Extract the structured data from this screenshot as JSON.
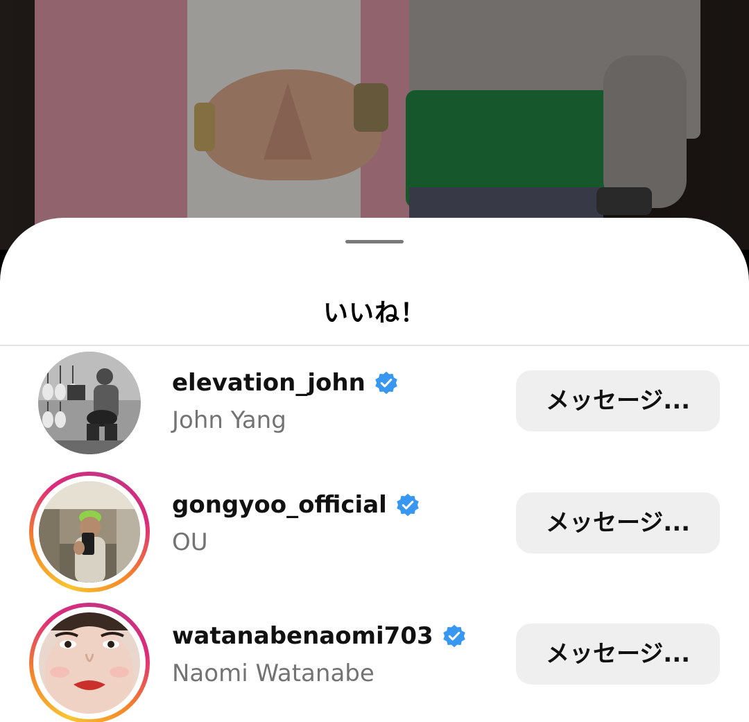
{
  "sheet": {
    "title": "いいね！"
  },
  "likes": [
    {
      "username": "elevation_john",
      "full_name": "John Yang",
      "verified": true,
      "story_ring": false,
      "avatar": "guitarist-bw-photo",
      "action_label": "メッセージ..."
    },
    {
      "username": "gongyoo_official",
      "full_name": "OU",
      "verified": true,
      "story_ring": true,
      "avatar": "mirror-selfie-green-cap-photo",
      "action_label": "メッセージ..."
    },
    {
      "username": "watanabenaomi703",
      "full_name": "Naomi Watanabe",
      "verified": true,
      "story_ring": true,
      "avatar": "portrait-red-lips-photo",
      "action_label": "メッセージ..."
    }
  ],
  "colors": {
    "verified_blue": "#3897f0",
    "button_bg": "#efefef",
    "secondary_text": "#737373",
    "ring_gradient": [
      "#f9c531",
      "#f58529",
      "#dd2a7b",
      "#c13584"
    ]
  },
  "icons": {
    "verified": "verified-badge-icon",
    "handle": "sheet-drag-handle"
  }
}
